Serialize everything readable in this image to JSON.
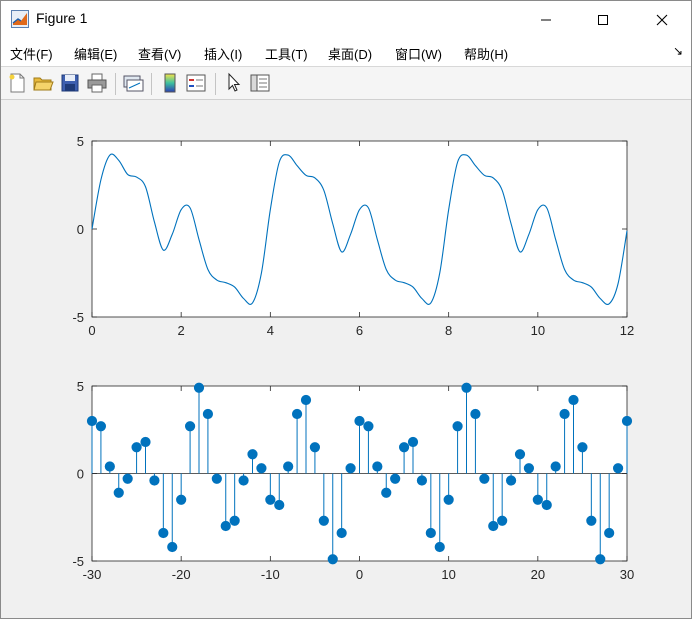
{
  "window": {
    "title": "Figure 1",
    "controls": [
      "minimize",
      "maximize",
      "close"
    ]
  },
  "menu": {
    "items": [
      "文件(F)",
      "编辑(E)",
      "查看(V)",
      "插入(I)",
      "工具(T)",
      "桌面(D)",
      "窗口(W)",
      "帮助(H)"
    ],
    "overflow_arrow": "↘"
  },
  "toolbar": {
    "buttons": [
      "new-figure-icon",
      "open-file-icon",
      "save-icon",
      "print-icon",
      "link-plot-icon",
      "colorbar-icon",
      "legend-icon",
      "pointer-icon",
      "property-inspector-icon"
    ]
  },
  "colors": {
    "series": "#0072BD",
    "axes": "#262626",
    "background": "#f0f0f0"
  },
  "chart_data": [
    {
      "type": "line",
      "title": "",
      "xlabel": "",
      "ylabel": "",
      "xlim": [
        0,
        12
      ],
      "ylim": [
        -5,
        5
      ],
      "xticks": [
        0,
        2,
        4,
        6,
        8,
        10,
        12
      ],
      "yticks": [
        -5,
        0,
        5
      ],
      "grid": false,
      "series": [
        {
          "x": [
            0,
            0.2,
            0.4,
            0.6,
            0.8,
            1.0,
            1.2,
            1.4,
            1.6,
            1.8,
            2.0,
            2.2,
            2.4,
            2.6,
            2.8,
            3.0,
            3.2,
            3.4,
            3.6,
            3.8,
            4.0,
            4.2,
            4.4,
            4.6,
            4.8,
            5.0,
            5.2,
            5.4,
            5.6,
            5.8,
            6.0,
            6.2,
            6.4,
            6.6,
            6.8,
            7.0,
            7.2,
            7.4,
            7.6,
            7.8,
            8.0,
            8.2,
            8.4,
            8.6,
            8.8,
            9.0,
            9.2,
            9.4,
            9.6,
            9.8,
            10.0,
            10.2,
            10.4,
            10.6,
            10.8,
            11.0,
            11.2,
            11.4,
            11.6,
            11.8,
            12.0
          ],
          "y": [
            0.0,
            2.8,
            4.2,
            3.9,
            3.1,
            2.95,
            2.4,
            0.4,
            -1.2,
            -0.3,
            1.1,
            1.2,
            -0.6,
            -2.3,
            -2.9,
            -3.05,
            -3.3,
            -3.95,
            -4.2,
            -2.5,
            1.1,
            3.8,
            4.2,
            3.6,
            3.05,
            2.9,
            2.2,
            0.3,
            -1.3,
            -0.3,
            1.1,
            1.2,
            -0.6,
            -2.3,
            -2.9,
            -3.05,
            -3.3,
            -3.95,
            -4.2,
            -2.5,
            1.1,
            3.8,
            4.2,
            3.6,
            3.05,
            2.9,
            2.2,
            0.3,
            -1.3,
            -0.3,
            1.1,
            1.2,
            -0.6,
            -2.3,
            -2.9,
            -3.05,
            -3.3,
            -3.95,
            -4.25,
            -3.1,
            -0.1
          ]
        }
      ]
    },
    {
      "type": "stem",
      "title": "",
      "xlabel": "",
      "ylabel": "",
      "xlim": [
        -30,
        30
      ],
      "ylim": [
        -5,
        5
      ],
      "xticks": [
        -30,
        -20,
        -10,
        0,
        10,
        20,
        30
      ],
      "yticks": [
        -5,
        0,
        5
      ],
      "grid": false,
      "series": [
        {
          "x": [
            -30,
            -29,
            -28,
            -27,
            -26,
            -25,
            -24,
            -23,
            -22,
            -21,
            -20,
            -19,
            -18,
            -17,
            -16,
            -15,
            -14,
            -13,
            -12,
            -11,
            -10,
            -9,
            -8,
            -7,
            -6,
            -5,
            -4,
            -3,
            -2,
            -1,
            0,
            1,
            2,
            3,
            4,
            5,
            6,
            7,
            8,
            9,
            10,
            11,
            12,
            13,
            14,
            15,
            16,
            17,
            18,
            19,
            20,
            21,
            22,
            23,
            24,
            25,
            26,
            27,
            28,
            29,
            30
          ],
          "y": [
            3.0,
            2.7,
            0.4,
            -1.1,
            -0.3,
            1.5,
            1.8,
            -0.4,
            -3.4,
            -4.2,
            -1.5,
            2.7,
            4.9,
            3.4,
            -0.3,
            -3.0,
            -2.7,
            -0.4,
            1.1,
            0.3,
            -1.5,
            -1.8,
            0.4,
            3.4,
            4.2,
            1.5,
            -2.7,
            -4.9,
            -3.4,
            0.3,
            3.0,
            2.7,
            0.4,
            -1.1,
            -0.3,
            1.5,
            1.8,
            -0.4,
            -3.4,
            -4.2,
            -1.5,
            2.7,
            4.9,
            3.4,
            -0.3,
            -3.0,
            -2.7,
            -0.4,
            1.1,
            0.3,
            -1.5,
            -1.8,
            0.4,
            3.4,
            4.2,
            1.5,
            -2.7,
            -4.9,
            -3.4,
            0.3,
            3.0
          ]
        }
      ]
    }
  ]
}
